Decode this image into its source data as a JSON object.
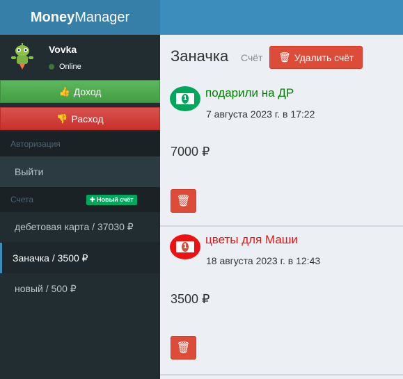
{
  "header": {
    "logo_bold": "Money",
    "logo_rest": "Manager"
  },
  "user": {
    "name": "Vovka",
    "status": "Online"
  },
  "actions": {
    "income": "Доход",
    "expense": "Расход"
  },
  "sidebar": {
    "auth_header": "Авторизация",
    "logout": "Выйти",
    "accounts_header": "Счета",
    "new_account_badge": "Новый счёт",
    "accounts": [
      {
        "label": "дебетовая карта / 37030 ₽"
      },
      {
        "label": "Заначка / 3500 ₽"
      },
      {
        "label": "новый / 500 ₽"
      }
    ]
  },
  "page": {
    "title": "Заначка",
    "subtitle": "Счёт",
    "delete_account": "Удалить счёт"
  },
  "transactions": [
    {
      "name": "подарили на ДР",
      "date": "7 августа 2023 г. в 17:22",
      "amount": "7000 ₽",
      "type": "income"
    },
    {
      "name": "цветы для Маши",
      "date": "18 августа 2023 г. в 12:43",
      "amount": "3500 ₽",
      "type": "expense"
    }
  ],
  "colors": {
    "income": "#008000",
    "expense": "#ee1111",
    "header": "#3c8dbc",
    "sidebar": "#222d32"
  }
}
